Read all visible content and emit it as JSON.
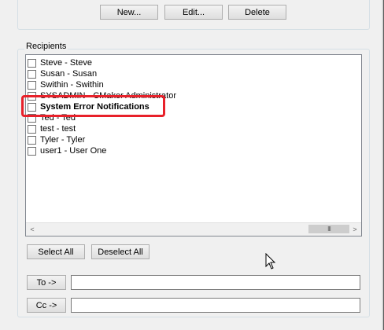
{
  "top_buttons": {
    "new_label": "New...",
    "edit_label": "Edit...",
    "delete_label": "Delete"
  },
  "recipients": {
    "group_label": "Recipients",
    "items": [
      {
        "label": "Steve  - Steve",
        "bold": false
      },
      {
        "label": "Susan  - Susan",
        "bold": false
      },
      {
        "label": "Swithin  - Swithin",
        "bold": false
      },
      {
        "label": "SYSADMIN  - CMaker Administrator",
        "bold": false
      },
      {
        "label": "System Error Notifications",
        "bold": true
      },
      {
        "label": "Ted  - Ted",
        "bold": false
      },
      {
        "label": "test  - test",
        "bold": false
      },
      {
        "label": "Tyler  - Tyler",
        "bold": false
      },
      {
        "label": "user1  - User One",
        "bold": false
      }
    ]
  },
  "select_all_label": "Select All",
  "deselect_all_label": "Deselect All",
  "to_button_label": "To ->",
  "cc_button_label": "Cc ->",
  "to_value": "",
  "cc_value": "",
  "scrollbar": {
    "left_arrow": "<",
    "right_arrow": ">",
    "grip": "III"
  },
  "colors": {
    "highlight": "#e8212a",
    "background": "#f0f0f0"
  },
  "icons": {
    "cursor": "pointer-cursor-icon"
  }
}
